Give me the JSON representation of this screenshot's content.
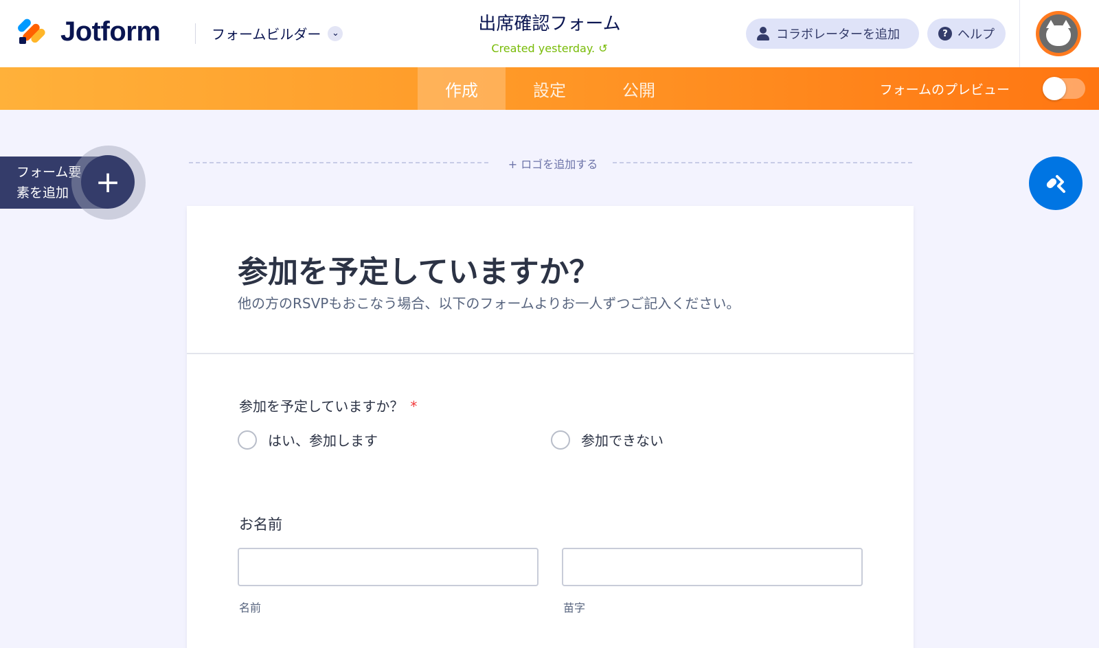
{
  "header": {
    "logo_text": "Jotform",
    "builder_label": "フォームビルダー",
    "form_title": "出席確認フォーム",
    "created_text": "Created yesterday.",
    "collaborator_label": "コラボレーターを追加",
    "help_label": "ヘルプ"
  },
  "tabs": [
    {
      "label": "作成",
      "active": true
    },
    {
      "label": "設定",
      "active": false
    },
    {
      "label": "公開",
      "active": false
    }
  ],
  "preview": {
    "label": "フォームのプレビュー",
    "enabled": false
  },
  "sidebar": {
    "add_element_line1": "フォーム要",
    "add_element_line2": "素を追加",
    "plus": "+"
  },
  "add_logo_label": "+ ロゴを追加する",
  "form": {
    "heading": "参加を予定していますか？",
    "subheading": "他の方のRSVPもおこなう場合、以下のフォームよりお一人ずつご記入ください。",
    "question1": {
      "label": "参加を予定していますか？",
      "required_mark": "*",
      "options": [
        "はい、参加します",
        "参加できない"
      ]
    },
    "name_field": {
      "label": "お名前",
      "first_sublabel": "名前",
      "last_sublabel": "苗字"
    }
  },
  "colors": {
    "accent_orange": "#ff7612",
    "brand_navy": "#0a1551",
    "designer_blue": "#0075e3",
    "created_green": "#78bb07"
  }
}
